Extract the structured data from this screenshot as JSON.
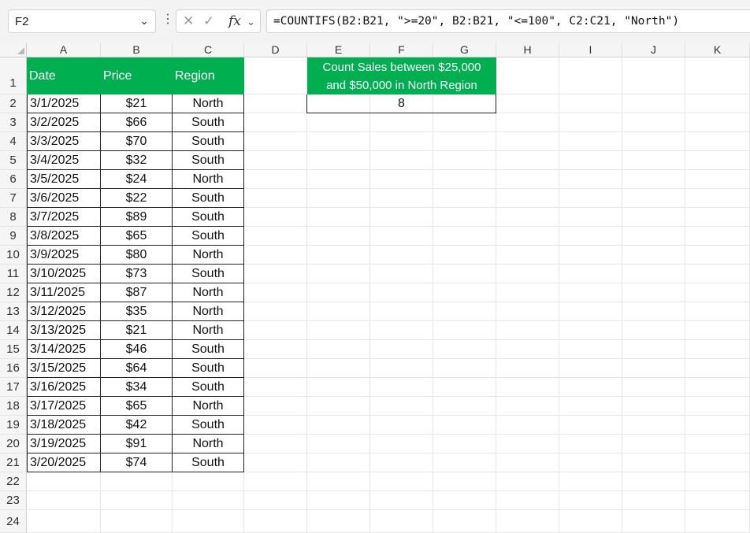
{
  "formula_bar": {
    "name_box": "F2",
    "fx_label": "fx",
    "cancel_glyph": "✕",
    "enter_glyph": "✓",
    "formula": "=COUNTIFS(B2:B21, \">=20\", B2:B21, \"<=100\", C2:C21, \"North\")"
  },
  "columns": [
    "A",
    "B",
    "C",
    "D",
    "E",
    "F",
    "G",
    "H",
    "I",
    "J",
    "K"
  ],
  "rows": [
    "1",
    "2",
    "3",
    "4",
    "5",
    "6",
    "7",
    "8",
    "9",
    "10",
    "11",
    "12",
    "13",
    "14",
    "15",
    "16",
    "17",
    "18",
    "19",
    "20",
    "21",
    "22",
    "23",
    "24"
  ],
  "table": {
    "headers": [
      "Date",
      "Price",
      "Region"
    ],
    "records": [
      [
        "3/1/2025",
        "$21",
        "North"
      ],
      [
        "3/2/2025",
        "$66",
        "South"
      ],
      [
        "3/3/2025",
        "$70",
        "South"
      ],
      [
        "3/4/2025",
        "$32",
        "South"
      ],
      [
        "3/5/2025",
        "$24",
        "North"
      ],
      [
        "3/6/2025",
        "$22",
        "South"
      ],
      [
        "3/7/2025",
        "$89",
        "South"
      ],
      [
        "3/8/2025",
        "$65",
        "South"
      ],
      [
        "3/9/2025",
        "$80",
        "North"
      ],
      [
        "3/10/2025",
        "$73",
        "South"
      ],
      [
        "3/11/2025",
        "$87",
        "North"
      ],
      [
        "3/12/2025",
        "$35",
        "North"
      ],
      [
        "3/13/2025",
        "$21",
        "North"
      ],
      [
        "3/14/2025",
        "$46",
        "South"
      ],
      [
        "3/15/2025",
        "$64",
        "South"
      ],
      [
        "3/16/2025",
        "$34",
        "South"
      ],
      [
        "3/17/2025",
        "$65",
        "North"
      ],
      [
        "3/18/2025",
        "$42",
        "South"
      ],
      [
        "3/19/2025",
        "$91",
        "North"
      ],
      [
        "3/20/2025",
        "$74",
        "South"
      ]
    ]
  },
  "summary": {
    "title_line1": "Count Sales between $25,000",
    "title_line2": "and $50,000 in North Region",
    "result": "8"
  },
  "colors": {
    "header_green": "#00b050",
    "header_text": "#ffffff"
  }
}
